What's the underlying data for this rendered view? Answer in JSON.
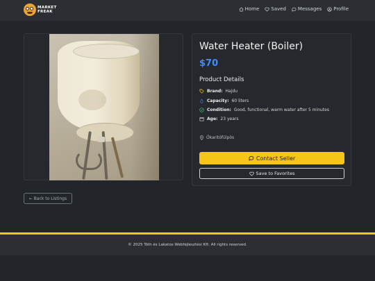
{
  "brand": {
    "logo_line1": "MARKET",
    "logo_line2": "FREAK"
  },
  "nav": {
    "home": "Home",
    "saved": "Saved",
    "messages": "Messages",
    "profile": "Profile"
  },
  "listing": {
    "title": "Water Heater (Boiler)",
    "price": "$70",
    "details_heading": "Product Details",
    "brand_label": "Brand:",
    "brand_value": "Hajdu",
    "capacity_label": "Capacity:",
    "capacity_value": "60 liters",
    "condition_label": "Condition:",
    "condition_value": "Good, functional, warm water after 5 minutes",
    "age_label": "Age:",
    "age_value": "23 years",
    "location": "Őkaritófülpös"
  },
  "actions": {
    "contact": "Contact Seller",
    "favorite": "Save to Favorites",
    "back": "← Back to Listings"
  },
  "footer": {
    "text": "© 2025 Tóth és Lakatos Webfejlesztési Kft. All rights reserved."
  },
  "colors": {
    "accent": "#f5c518",
    "price": "#3f8cff",
    "background": "#222529"
  }
}
